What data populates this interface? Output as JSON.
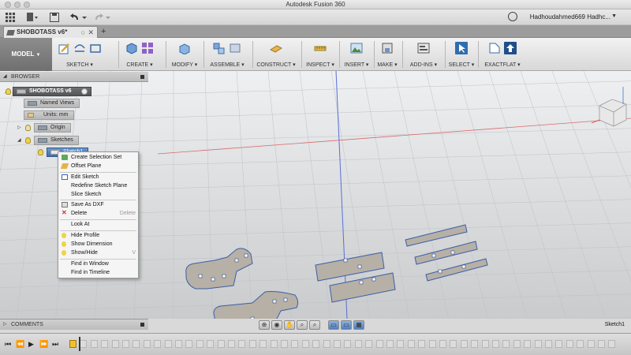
{
  "window": {
    "title": "Autodesk Fusion 360"
  },
  "quick_access": {
    "user_name": "Hadhoudahmed669 Hadhc...",
    "icons": [
      "grid-icon",
      "file-icon",
      "save-icon",
      "undo-icon",
      "redo-icon",
      "clock-icon"
    ]
  },
  "document_tab": {
    "name": "SHOBOTASS v6*"
  },
  "toolbar": {
    "workspace": "MODEL",
    "groups": [
      {
        "label": "SKETCH ▾"
      },
      {
        "label": "CREATE ▾"
      },
      {
        "label": "MODIFY ▾"
      },
      {
        "label": "ASSEMBLE ▾"
      },
      {
        "label": "CONSTRUCT ▾"
      },
      {
        "label": "INSPECT ▾"
      },
      {
        "label": "INSERT ▾"
      },
      {
        "label": "MAKE ▾"
      },
      {
        "label": "ADD-INS ▾"
      },
      {
        "label": "SELECT ▾"
      },
      {
        "label": "EXACTFLAT ▾"
      }
    ]
  },
  "browser": {
    "header": "BROWSER",
    "root": "SHOBOTASS v6",
    "items": [
      {
        "label": "Named Views"
      },
      {
        "label": "Units: mm"
      },
      {
        "label": "Origin"
      },
      {
        "label": "Sketches"
      },
      {
        "label": "Sketch1"
      }
    ]
  },
  "context_menu": {
    "items": [
      {
        "label": "Create Selection Set",
        "shortcut": ""
      },
      {
        "label": "Offset Plane",
        "shortcut": ""
      },
      {
        "label": "Edit Sketch",
        "shortcut": ""
      },
      {
        "label": "Redefine Sketch Plane",
        "shortcut": ""
      },
      {
        "label": "Slice Sketch",
        "shortcut": ""
      },
      {
        "label": "Save As DXF",
        "shortcut": ""
      },
      {
        "label": "Delete",
        "shortcut": "Delete"
      },
      {
        "label": "Look At",
        "shortcut": ""
      },
      {
        "label": "Hide Profile",
        "shortcut": ""
      },
      {
        "label": "Show Dimension",
        "shortcut": ""
      },
      {
        "label": "Show/Hide",
        "shortcut": "V"
      },
      {
        "label": "Find in Window",
        "shortcut": ""
      },
      {
        "label": "Find in Timeline",
        "shortcut": ""
      }
    ]
  },
  "comments": {
    "label": "COMMENTS"
  },
  "status": {
    "active_sketch": "Sketch1"
  },
  "colors": {
    "accent": "#3d7ab8",
    "sketch_fill": "#b7b0a6",
    "sketch_edge": "#3b5fa8"
  }
}
